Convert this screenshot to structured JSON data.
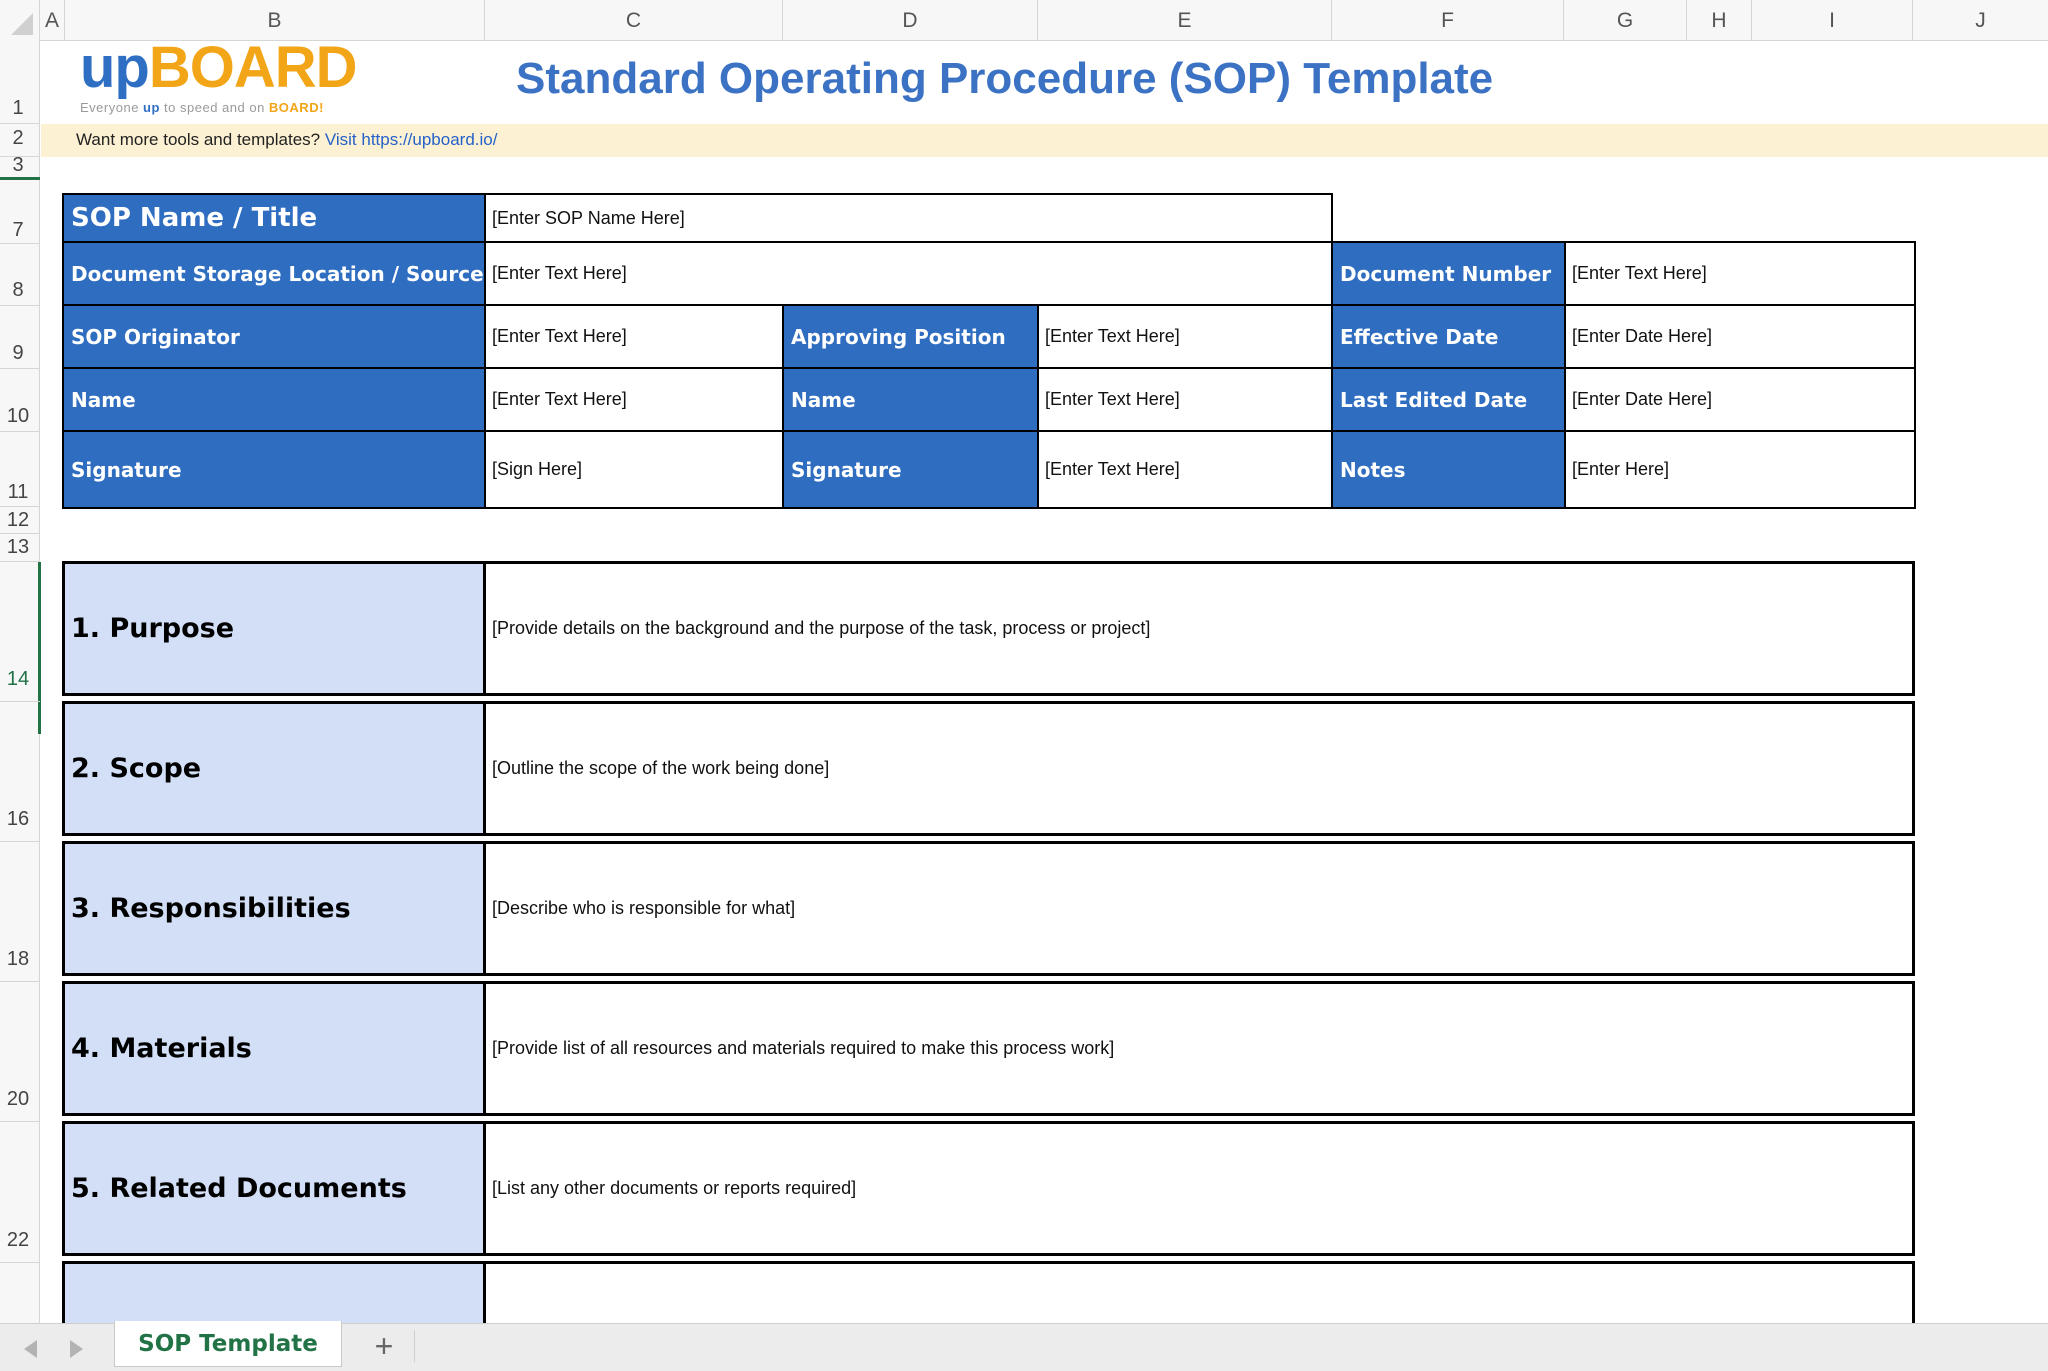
{
  "sheet": {
    "columns": [
      "A",
      "B",
      "C",
      "D",
      "E",
      "F",
      "G",
      "H",
      "I",
      "J"
    ],
    "rows": [
      "1",
      "2",
      "3",
      "7",
      "8",
      "9",
      "10",
      "11",
      "12",
      "13",
      "14",
      "16",
      "18",
      "20",
      "22"
    ]
  },
  "logo": {
    "up": "up",
    "board": "BOARD",
    "tagline_pre": "Everyone ",
    "tagline_up": "up",
    "tagline_mid": " to speed and on ",
    "tagline_board": "BOARD!"
  },
  "title": "Standard Operating Procedure (SOP) Template",
  "promo": {
    "text": "Want more tools and templates? ",
    "link": "Visit https://upboard.io/"
  },
  "info": {
    "sop_name_label": "SOP Name / Title",
    "sop_name_value": "[Enter SOP Name Here]",
    "storage_label": "Document Storage Location / Source",
    "storage_value": "[Enter Text Here]",
    "doc_number_label": "Document Number",
    "doc_number_value": "[Enter Text Here]",
    "originator_label": "SOP Originator",
    "originator_value": "[Enter Text Here]",
    "approving_label": "Approving Position",
    "approving_value": "[Enter Text Here]",
    "effective_label": "Effective Date",
    "effective_value": "[Enter Date Here]",
    "name_label_1": "Name",
    "name_value_1": "[Enter Text Here]",
    "name_label_2": "Name",
    "name_value_2": "[Enter Text Here]",
    "last_edited_label": "Last Edited Date",
    "last_edited_value": "[Enter Date Here]",
    "signature_label_1": "Signature",
    "signature_value_1": "[Sign Here]",
    "signature_label_2": "Signature",
    "signature_value_2": "[Enter Text Here]",
    "notes_label": "Notes",
    "notes_value": "[Enter Here]"
  },
  "sections": [
    {
      "title": "1. Purpose",
      "body": "[Provide details on the background and the purpose of the task, process or project]"
    },
    {
      "title": "2. Scope",
      "body": "[Outline the scope of the work being done]"
    },
    {
      "title": "3. Responsibilities",
      "body": "[Describe who is responsible for what]"
    },
    {
      "title": "4. Materials",
      "body": "[Provide list of all resources and materials required to make this process work]"
    },
    {
      "title": "5. Related Documents",
      "body": "[List any other documents or reports required]"
    }
  ],
  "tabs": {
    "active": "SOP Template",
    "add": "+"
  },
  "colors": {
    "header_blue": "#2f6dc0",
    "section_blue": "#d2dff6",
    "title_blue": "#3b72c4",
    "promo_bg": "#fdf1d3",
    "excel_green": "#217346"
  }
}
